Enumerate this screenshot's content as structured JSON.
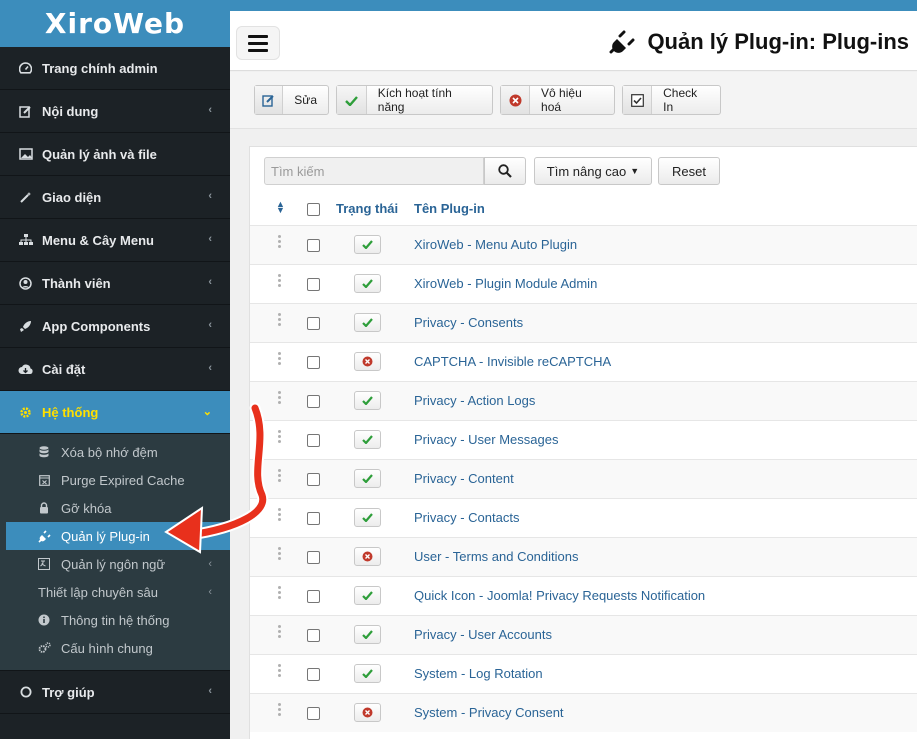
{
  "brand": "XiroWeb",
  "sidebar": {
    "items": [
      {
        "label": "Trang chính admin",
        "icon": "dashboard-icon",
        "chevron": false
      },
      {
        "label": "Nội dung",
        "icon": "edit-icon",
        "chevron": true
      },
      {
        "label": "Quản lý ảnh và file",
        "icon": "image-icon",
        "chevron": false
      },
      {
        "label": "Giao diện",
        "icon": "magic-wand-icon",
        "chevron": true
      },
      {
        "label": "Menu & Cây Menu",
        "icon": "sitemap-icon",
        "chevron": true
      },
      {
        "label": "Thành viên",
        "icon": "user-circle-icon",
        "chevron": true
      },
      {
        "label": "App Components",
        "icon": "rocket-icon",
        "chevron": true
      },
      {
        "label": "Cài đặt",
        "icon": "cloud-download-icon",
        "chevron": true
      },
      {
        "label": "Hệ thống",
        "icon": "gear-icon",
        "chevron": true
      }
    ],
    "system_sub": [
      {
        "label": "Xóa bộ nhớ đệm",
        "icon": "database-icon"
      },
      {
        "label": "Purge Expired Cache",
        "icon": "calendar-x-icon"
      },
      {
        "label": "Gỡ khóa",
        "icon": "lock-icon"
      },
      {
        "label": "Quản lý Plug-in",
        "icon": "plug-icon"
      },
      {
        "label": "Quản lý ngôn ngữ",
        "icon": "language-icon"
      },
      {
        "label": "Thiết lập chuyên sâu",
        "icon": ""
      },
      {
        "label": "Thông tin hệ thống",
        "icon": "info-icon"
      },
      {
        "label": "Cấu hình chung",
        "icon": "cogs-icon"
      }
    ],
    "help": "Trợ giúp"
  },
  "header": {
    "title": "Quản lý Plug-in: Plug-ins"
  },
  "toolbar": {
    "edit": "Sửa",
    "enable": "Kích hoạt tính năng",
    "disable": "Vô hiệu hoá",
    "checkin": "Check In"
  },
  "filters": {
    "search_placeholder": "Tìm kiếm",
    "advanced": "Tìm nâng cao",
    "reset": "Reset"
  },
  "table": {
    "col_status": "Trạng thái",
    "col_name": "Tên Plug-in",
    "rows": [
      {
        "name": "XiroWeb - Menu Auto Plugin",
        "enabled": true
      },
      {
        "name": "XiroWeb - Plugin Module Admin",
        "enabled": true
      },
      {
        "name": "Privacy - Consents",
        "enabled": true
      },
      {
        "name": "CAPTCHA - Invisible reCAPTCHA",
        "enabled": false
      },
      {
        "name": "Privacy - Action Logs",
        "enabled": true
      },
      {
        "name": "Privacy - User Messages",
        "enabled": true
      },
      {
        "name": "Privacy - Content",
        "enabled": true
      },
      {
        "name": "Privacy - Contacts",
        "enabled": true
      },
      {
        "name": "User - Terms and Conditions",
        "enabled": false
      },
      {
        "name": "Quick Icon - Joomla! Privacy Requests Notification",
        "enabled": true
      },
      {
        "name": "Privacy - User Accounts",
        "enabled": true
      },
      {
        "name": "System - Log Rotation",
        "enabled": true
      },
      {
        "name": "System - Privacy Consent",
        "enabled": false
      }
    ]
  },
  "colors": {
    "accent": "#3c8dbc",
    "sidebar_bg": "#1c2226",
    "active_text": "#ffe000",
    "annotation_arrow": "#e8301c",
    "enabled": "#2e9e3a",
    "disabled": "#c0392b"
  }
}
